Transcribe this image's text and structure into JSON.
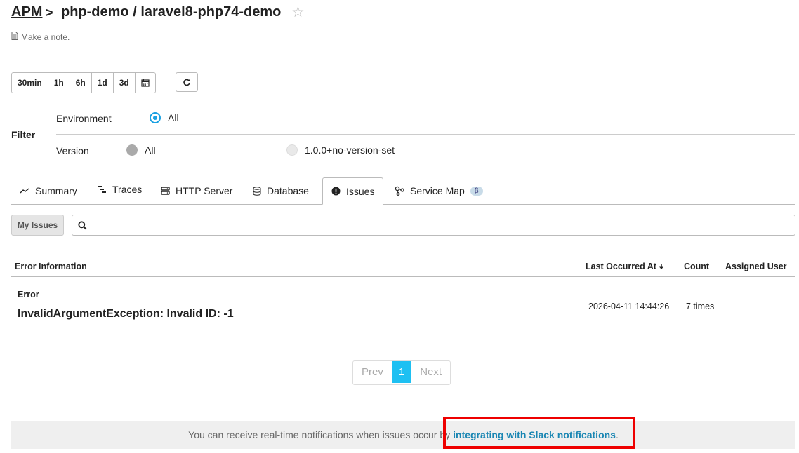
{
  "header": {
    "root_link": "APM",
    "separator": ">",
    "title": "php-demo / laravel8-php74-demo",
    "note_placeholder": "Make a note."
  },
  "time_range": {
    "buttons": [
      "30min",
      "1h",
      "6h",
      "1d",
      "3d"
    ]
  },
  "filter": {
    "label": "Filter",
    "environment_label": "Environment",
    "environment_options": [
      {
        "label": "All",
        "selected": true
      }
    ],
    "version_label": "Version",
    "version_options": [
      {
        "label": "All",
        "selected": false
      },
      {
        "label": "1.0.0+no-version-set",
        "selected": false
      }
    ]
  },
  "tabs": [
    {
      "label": "Summary",
      "icon": "trend-icon"
    },
    {
      "label": "Traces",
      "icon": "traces-icon"
    },
    {
      "label": "HTTP Server",
      "icon": "server-icon"
    },
    {
      "label": "Database",
      "icon": "database-icon"
    },
    {
      "label": "Issues",
      "icon": "alert-icon",
      "active": true
    },
    {
      "label": "Service Map",
      "icon": "service-map-icon",
      "badge": "β"
    }
  ],
  "issues": {
    "my_issues_label": "My Issues",
    "search_placeholder": "",
    "columns": {
      "error_information": "Error Information",
      "last_occurred": "Last Occurred At",
      "count": "Count",
      "assigned_user": "Assigned User"
    },
    "rows": [
      {
        "type": "Error",
        "message": "InvalidArgumentException: Invalid ID: -1",
        "last_occurred": "2026-04-11 14:44:26",
        "count": "7 times",
        "assigned_user": ""
      }
    ]
  },
  "pagination": {
    "prev": "Prev",
    "current": "1",
    "next": "Next"
  },
  "notice": {
    "text": "You can receive real-time notifications when issues occur by",
    "link": "integrating with Slack notifications",
    "suffix": "."
  },
  "colors": {
    "accent": "#1ba1e2",
    "pager_active": "#1ec0f2",
    "link": "#1a86b3",
    "highlight": "#e00000"
  }
}
